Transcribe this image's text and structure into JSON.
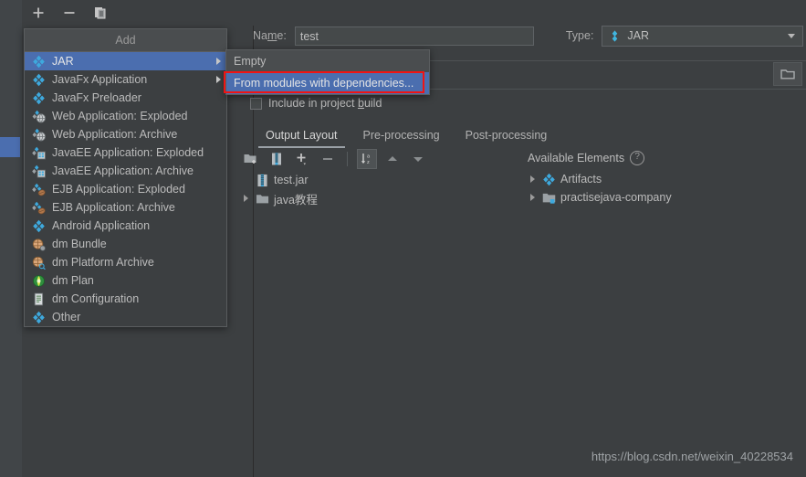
{
  "window": {
    "background_color": "#3C3F41",
    "accent_color": "#4B6EAF",
    "highlight_box_color": "#F01414"
  },
  "left_panel": {
    "toolbar": [
      {
        "name": "add-button",
        "icon": "plus-icon",
        "label": "+"
      },
      {
        "name": "remove-button",
        "icon": "minus-icon",
        "label": "−"
      },
      {
        "name": "copy-button",
        "icon": "copy-icon",
        "label": ""
      }
    ]
  },
  "add_menu": {
    "title": "Add",
    "items": [
      {
        "label": "JAR",
        "icon": "artifact-jar-icon",
        "selected": true,
        "has_submenu": true
      },
      {
        "label": "JavaFx Application",
        "icon": "artifact-jar-icon",
        "selected": false,
        "has_submenu": true
      },
      {
        "label": "JavaFx Preloader",
        "icon": "artifact-jar-icon",
        "selected": false,
        "has_submenu": false
      },
      {
        "label": "Web Application: Exploded",
        "icon": "web-artifact-icon",
        "selected": false,
        "has_submenu": false
      },
      {
        "label": "Web Application: Archive",
        "icon": "web-artifact-icon",
        "selected": false,
        "has_submenu": false
      },
      {
        "label": "JavaEE Application: Exploded",
        "icon": "javaee-artifact-icon",
        "selected": false,
        "has_submenu": false
      },
      {
        "label": "JavaEE Application: Archive",
        "icon": "javaee-artifact-icon",
        "selected": false,
        "has_submenu": false
      },
      {
        "label": "EJB Application: Exploded",
        "icon": "ejb-artifact-icon",
        "selected": false,
        "has_submenu": false
      },
      {
        "label": "EJB Application: Archive",
        "icon": "ejb-artifact-icon",
        "selected": false,
        "has_submenu": false
      },
      {
        "label": "Android Application",
        "icon": "artifact-jar-icon",
        "selected": false,
        "has_submenu": false
      },
      {
        "label": "dm Bundle",
        "icon": "dm-bundle-icon",
        "selected": false,
        "has_submenu": false
      },
      {
        "label": "dm Platform Archive",
        "icon": "dm-platform-icon",
        "selected": false,
        "has_submenu": false
      },
      {
        "label": "dm Plan",
        "icon": "dm-plan-icon",
        "selected": false,
        "has_submenu": false
      },
      {
        "label": "dm Configuration",
        "icon": "dm-config-icon",
        "selected": false,
        "has_submenu": false
      },
      {
        "label": "Other",
        "icon": "artifact-jar-icon",
        "selected": false,
        "has_submenu": false
      }
    ]
  },
  "sub_menu": {
    "items": [
      {
        "label": "Empty",
        "selected": false
      },
      {
        "label": "From modules with dependencies...",
        "selected": true
      }
    ]
  },
  "form": {
    "name_label": "Na",
    "name_label_mnemonic": "m",
    "name_label_rest": "e:",
    "name_value": "test",
    "type_label": "Type:",
    "type_value": "JAR",
    "type_icon": "artifact-jar-icon",
    "output_directory_value": "",
    "browse_icon": "folder-open-icon",
    "include_in_build": {
      "label_before": "Include in project ",
      "label_mnemonic": "b",
      "label_after": "uild",
      "checked": false
    }
  },
  "tabs": [
    {
      "label": "Output Layout",
      "active": true
    },
    {
      "label": "Pre-processing",
      "active": false
    },
    {
      "label": "Post-processing",
      "active": false
    }
  ],
  "output_layout": {
    "toolbar": [
      {
        "name": "create-directory-button",
        "icon": "new-folder-icon"
      },
      {
        "name": "create-archive-button",
        "icon": "archive-icon"
      },
      {
        "name": "add-copy-of-button",
        "icon": "plus-dropdown-icon"
      },
      {
        "name": "remove-button",
        "icon": "minus-icon"
      },
      {
        "name": "sort-button",
        "icon": "sort-az-icon",
        "pressed": true
      },
      {
        "name": "move-up-button",
        "icon": "arrow-up-icon"
      },
      {
        "name": "move-down-button",
        "icon": "arrow-down-icon"
      }
    ],
    "tree": [
      {
        "label": "test.jar",
        "icon": "archive-icon",
        "expandable": false,
        "depth": 0
      },
      {
        "label": "java教程",
        "icon": "folder-icon",
        "expandable": true,
        "depth": 0
      }
    ]
  },
  "available_elements": {
    "title": "Available Elements",
    "help_icon": "help-icon",
    "tree": [
      {
        "label": "Artifacts",
        "icon": "artifact-jar-icon",
        "expandable": true
      },
      {
        "label": "practisejava-company",
        "icon": "module-icon",
        "expandable": true
      }
    ]
  },
  "watermark": {
    "text": "https://blog.csdn.net/weixin_40228534"
  }
}
